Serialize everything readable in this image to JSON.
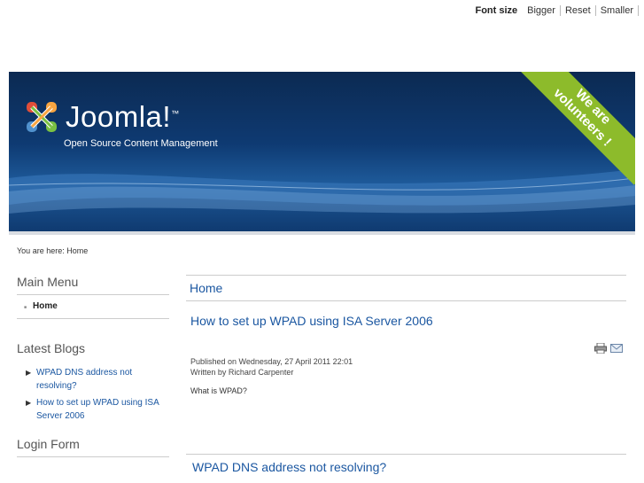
{
  "fontsize": {
    "label": "Font size",
    "bigger": "Bigger",
    "reset": "Reset",
    "smaller": "Smaller"
  },
  "banner": {
    "logo": "Joomla!",
    "tm": "™",
    "tagline": "Open Source Content Management",
    "ribbon1": "We are",
    "ribbon2": "volunteers !"
  },
  "breadcrumb": "You are here: Home",
  "sidebar": {
    "main_menu_title": "Main Menu",
    "main_menu_items": [
      "Home"
    ],
    "latest_blogs_title": "Latest Blogs",
    "latest_blogs": [
      "WPAD DNS address not resolving?",
      "How to set up WPAD using ISA Server 2006"
    ],
    "login_title": "Login Form"
  },
  "main": {
    "page_title": "Home",
    "article_title": "How to set up WPAD using ISA Server 2006",
    "published": "Published on Wednesday, 27 April 2011 22:01",
    "author": "Written by Richard Carpenter",
    "body": "What is WPAD?",
    "article2_title": "WPAD DNS address not resolving?"
  }
}
